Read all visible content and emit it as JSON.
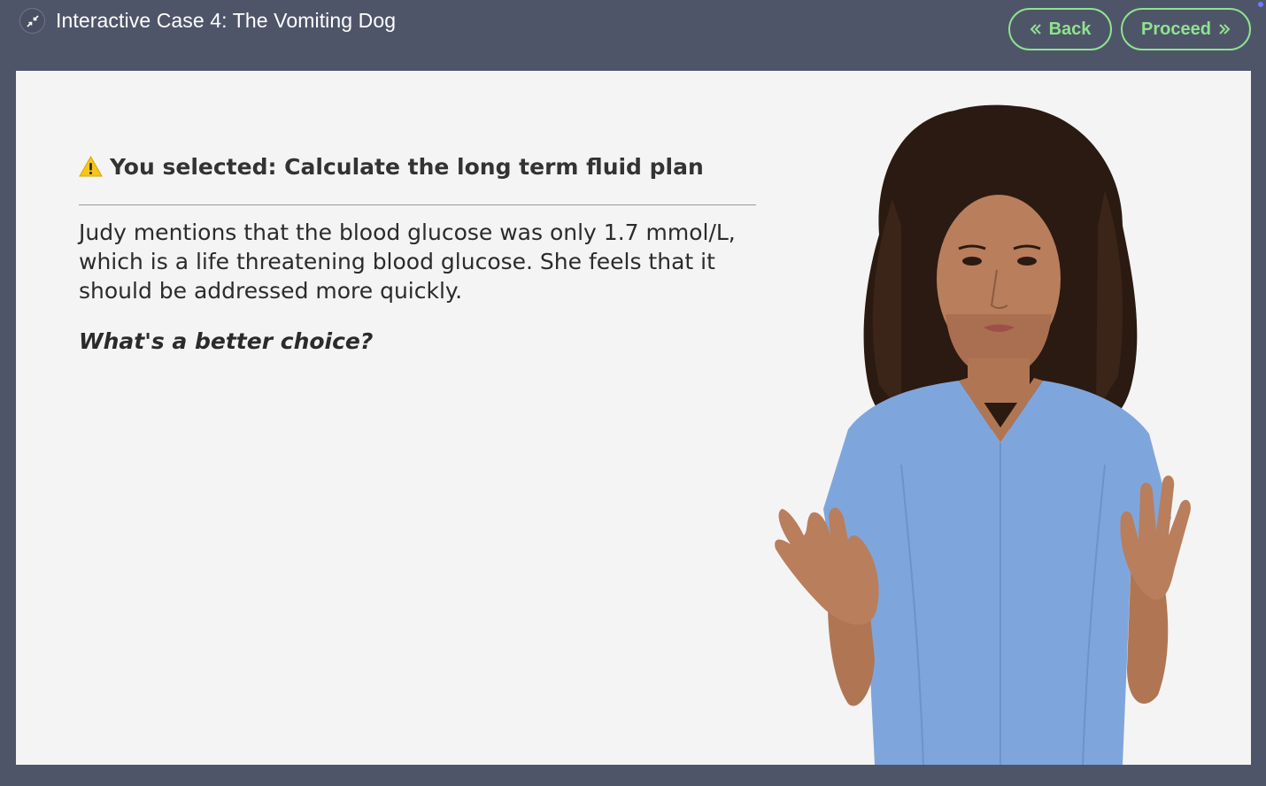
{
  "header": {
    "title": "Interactive Case 4: The Vomiting Dog",
    "back_label": "Back",
    "proceed_label": "Proceed"
  },
  "feedback": {
    "selected_text": "You selected: Calculate the long term fluid plan",
    "body": "Judy mentions that the blood glucose was only 1.7 mmol/L, which is a life threatening blood glucose. She feels that it should be addressed more quickly.",
    "question": "What's a better choice?"
  },
  "icons": {
    "collapse": "collapse-arrows-icon",
    "warning": "warning-icon",
    "back": "double-chevron-left-icon",
    "proceed": "double-chevron-right-icon"
  },
  "colors": {
    "frame": "#4f5569",
    "accent_green": "#8ee38e",
    "panel_bg": "#f4f4f4",
    "warning_yellow": "#f5c518",
    "scrubs_blue": "#7fa6dc"
  }
}
